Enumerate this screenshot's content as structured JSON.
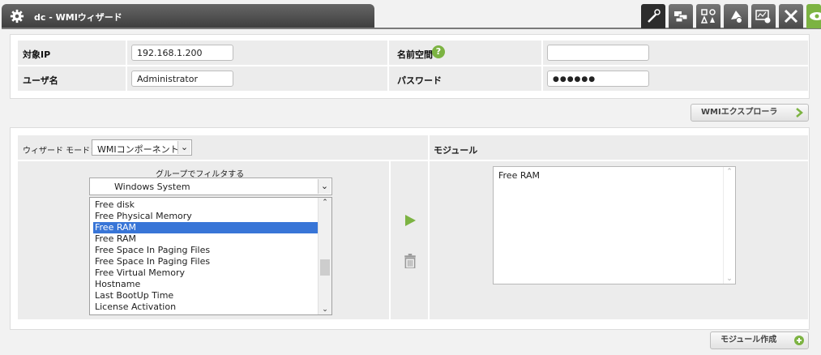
{
  "header": {
    "title": "dc - WMIウィザード",
    "toolbar_icons": [
      "wizard-wand-icon",
      "modules-icon",
      "shapes-icon",
      "alerts-icon",
      "monitor-settings-icon",
      "tools-icon",
      "view-eye-icon"
    ]
  },
  "credentials": {
    "target_ip_label": "対象IP",
    "target_ip_value": "192.168.1.200",
    "namespace_label": "名前空間",
    "namespace_value": "",
    "help_glyph": "?",
    "user_label": "ユーザ名",
    "user_value": "Administrator",
    "password_label": "パスワード",
    "password_value": "●●●●●●"
  },
  "explorer_button": "WMIエクスプローラ",
  "wizard": {
    "mode_label": "ウィザード モード：",
    "mode_value": "WMIコンポーネント",
    "module_header": "モジュール",
    "filter_label": "グループでフィルタする",
    "filter_value": "Windows System",
    "available_items": [
      "Free disk",
      "Free Physical Memory",
      "Free RAM",
      "Free RAM",
      "Free Space In Paging Files",
      "Free Space In Paging Files",
      "Free Virtual Memory",
      "Hostname",
      "Last BootUp Time",
      "License Activation"
    ],
    "selected_index": 2,
    "selected_modules": [
      "Free RAM"
    ]
  },
  "create_button": "モジュール作成",
  "colors": {
    "accent_green": "#7cb342",
    "selection_blue": "#3875d7",
    "header_dark": "#4a4a4a"
  }
}
